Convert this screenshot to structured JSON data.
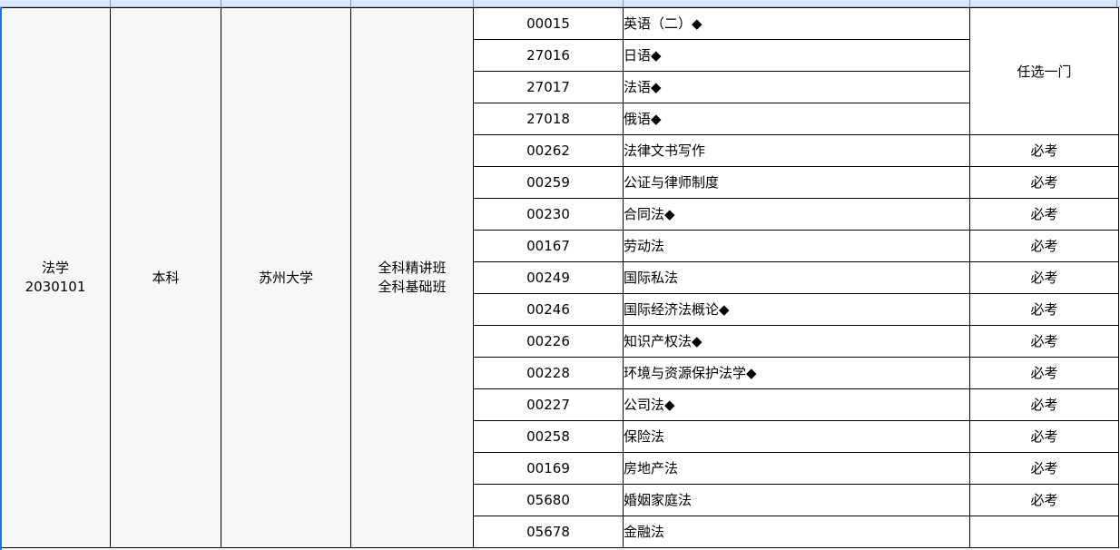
{
  "major": {
    "name": "法学",
    "code": "2030101"
  },
  "level": "本科",
  "school": "苏州大学",
  "classes": {
    "line1": "全科精讲班",
    "line2": "全科基础班"
  },
  "elective_group_label": "任选一门",
  "courses": [
    {
      "code": "00015",
      "name": "英语（二）◆",
      "status": ""
    },
    {
      "code": "27016",
      "name": "日语◆",
      "status": ""
    },
    {
      "code": "27017",
      "name": "法语◆",
      "status": ""
    },
    {
      "code": "27018",
      "name": "俄语◆",
      "status": ""
    },
    {
      "code": "00262",
      "name": "法律文书写作",
      "status": "必考"
    },
    {
      "code": "00259",
      "name": "公证与律师制度",
      "status": "必考"
    },
    {
      "code": "00230",
      "name": "合同法◆",
      "status": "必考"
    },
    {
      "code": "00167",
      "name": "劳动法",
      "status": "必考"
    },
    {
      "code": "00249",
      "name": "国际私法",
      "status": "必考"
    },
    {
      "code": "00246",
      "name": "国际经济法概论◆",
      "status": "必考"
    },
    {
      "code": "00226",
      "name": "知识产权法◆",
      "status": "必考"
    },
    {
      "code": "00228",
      "name": "环境与资源保护法学◆",
      "status": "必考"
    },
    {
      "code": "00227",
      "name": "公司法◆",
      "status": "必考"
    },
    {
      "code": "00258",
      "name": "保险法",
      "status": "必考"
    },
    {
      "code": "00169",
      "name": "房地产法",
      "status": "必考"
    },
    {
      "code": "05680",
      "name": "婚姻家庭法",
      "status": "必考"
    },
    {
      "code": "05678",
      "name": "金融法",
      "status": ""
    }
  ]
}
